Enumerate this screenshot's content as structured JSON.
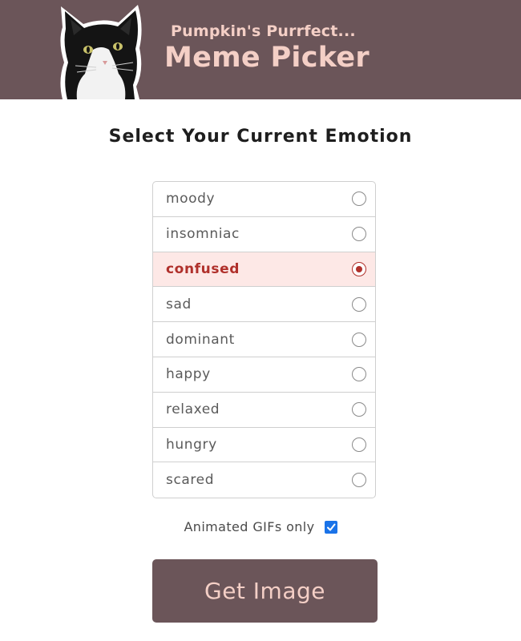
{
  "header": {
    "subtitle": "Pumpkin's Purrfect...",
    "title": "Meme Picker",
    "background_color": "#6b5559",
    "text_color": "#f4cfc6",
    "logo_icon": "cat-photo"
  },
  "main": {
    "heading": "Select Your Current Emotion",
    "emotions": [
      {
        "label": "moody",
        "selected": false
      },
      {
        "label": "insomniac",
        "selected": false
      },
      {
        "label": "confused",
        "selected": true
      },
      {
        "label": "sad",
        "selected": false
      },
      {
        "label": "dominant",
        "selected": false
      },
      {
        "label": "happy",
        "selected": false
      },
      {
        "label": "relaxed",
        "selected": false
      },
      {
        "label": "hungry",
        "selected": false
      },
      {
        "label": "scared",
        "selected": false
      }
    ],
    "selected_color": "#b0302b",
    "selected_background": "#fde8e6",
    "gif_only_label": "Animated GIFs only",
    "gif_only_checked": true,
    "submit_label": "Get Image"
  }
}
